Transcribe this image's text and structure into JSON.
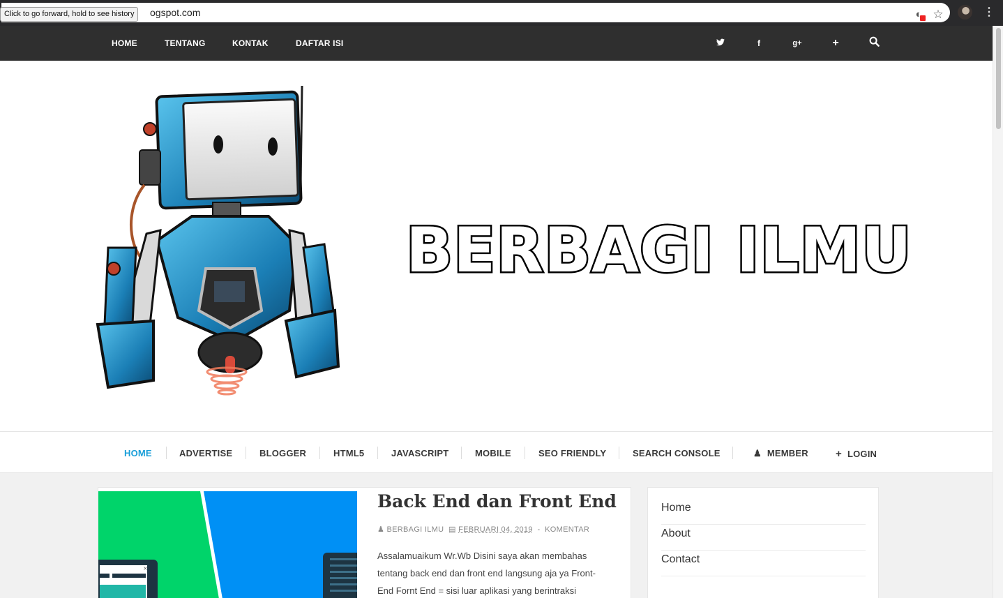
{
  "browser": {
    "url_visible": "ogspot.com",
    "tooltip": "Click to go forward, hold to see history",
    "icons": [
      "extension-icon",
      "bookmark-star-icon",
      "profile-avatar",
      "menu-dots-icon"
    ]
  },
  "topnav": {
    "links": [
      "HOME",
      "TENTANG",
      "KONTAK",
      "DAFTAR ISI"
    ],
    "social_icons": [
      "twitter-icon",
      "facebook-icon",
      "google-plus-icon",
      "plus-icon",
      "search-icon"
    ],
    "background": "#2f2f2f"
  },
  "header": {
    "brand_title": "BERBAGI ILMU",
    "logo_icon": "robot-mascot"
  },
  "catnav": {
    "items": [
      "HOME",
      "ADVERTISE",
      "BLOGGER",
      "HTML5",
      "JAVASCRIPT",
      "MOBILE",
      "SEO FRIENDLY",
      "SEARCH CONSOLE"
    ],
    "member_label": "MEMBER",
    "login_label": "LOGIN",
    "active_color": "#1a9fd9"
  },
  "post": {
    "title": "Back End dan Front End",
    "author": "BERBAGI ILMU",
    "date": "FEBRUARI 04, 2019",
    "separator": "-",
    "comments": "KOMENTAR",
    "excerpt": "Assalamuaikum Wr.Wb Disini saya akan membahas tentang back end dan front end langsung aja ya  Front-End Fornt End = sisi luar aplikasi yang berintraksi"
  },
  "sidebar": {
    "links": [
      "Home",
      "About",
      "Contact"
    ]
  }
}
